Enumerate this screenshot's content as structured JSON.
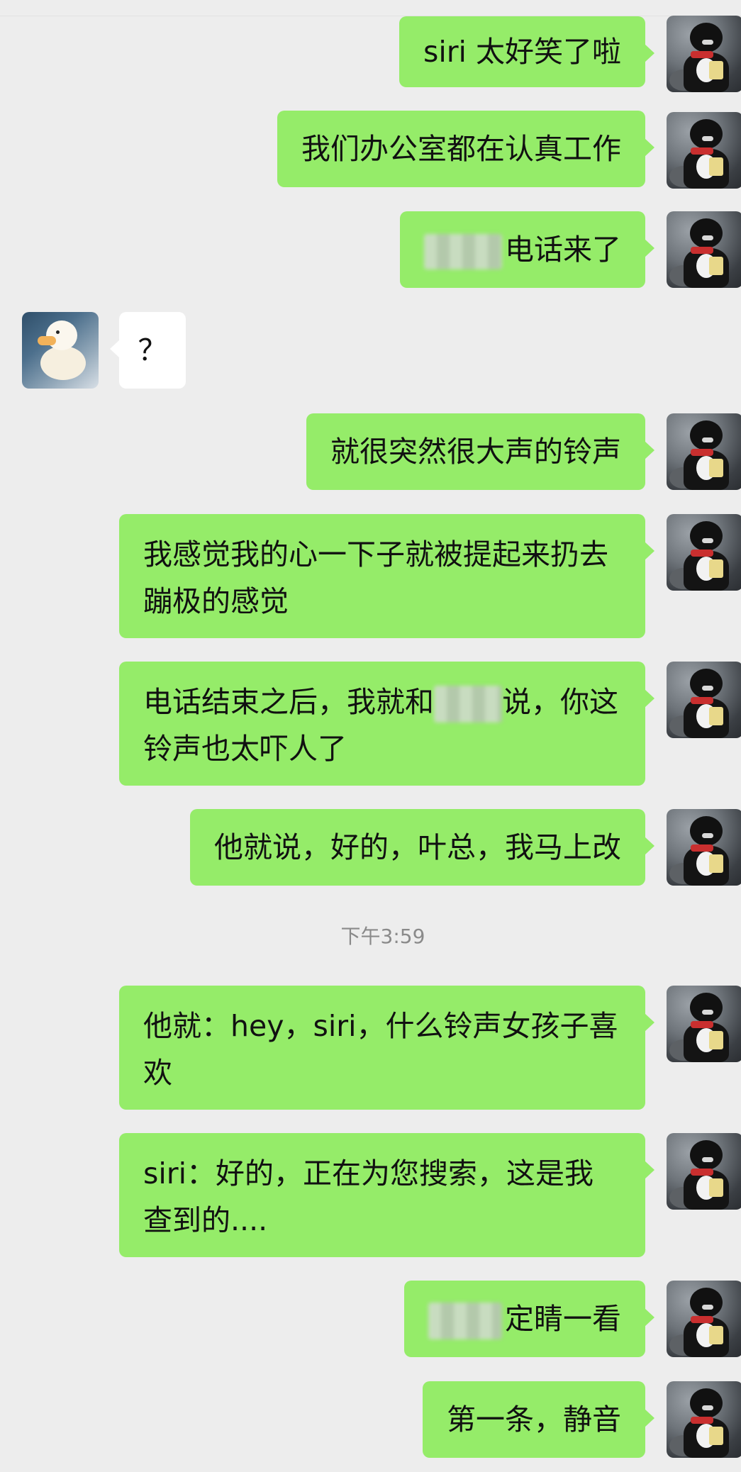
{
  "chat": {
    "timestamp": "下午3:59",
    "messages": [
      {
        "side": "me",
        "text": "siri 太好笑了啦"
      },
      {
        "side": "me",
        "text": "我们办公室都在认真工作"
      },
      {
        "side": "me",
        "text": "电话来了",
        "redacted": "prefix"
      },
      {
        "side": "other",
        "text": "？"
      },
      {
        "side": "me",
        "text": "就很突然很大声的铃声"
      },
      {
        "side": "me",
        "text": "我感觉我的心一下子就被提起来扔去蹦极的感觉"
      },
      {
        "side": "me",
        "text_before": "电话结束之后，我就和",
        "text_after": "说，你这铃声也太吓人了",
        "redacted": "middle"
      },
      {
        "side": "me",
        "text": "他就说，好的，叶总，我马上改"
      },
      {
        "side": "me",
        "text": "他就：hey，siri，什么铃声女孩子喜欢"
      },
      {
        "side": "me",
        "text": "siri：好的，正在为您搜索，这是我查到的...."
      },
      {
        "side": "me",
        "text": "定睛一看",
        "redacted": "prefix"
      },
      {
        "side": "me",
        "text": "第一条，静音"
      }
    ]
  }
}
